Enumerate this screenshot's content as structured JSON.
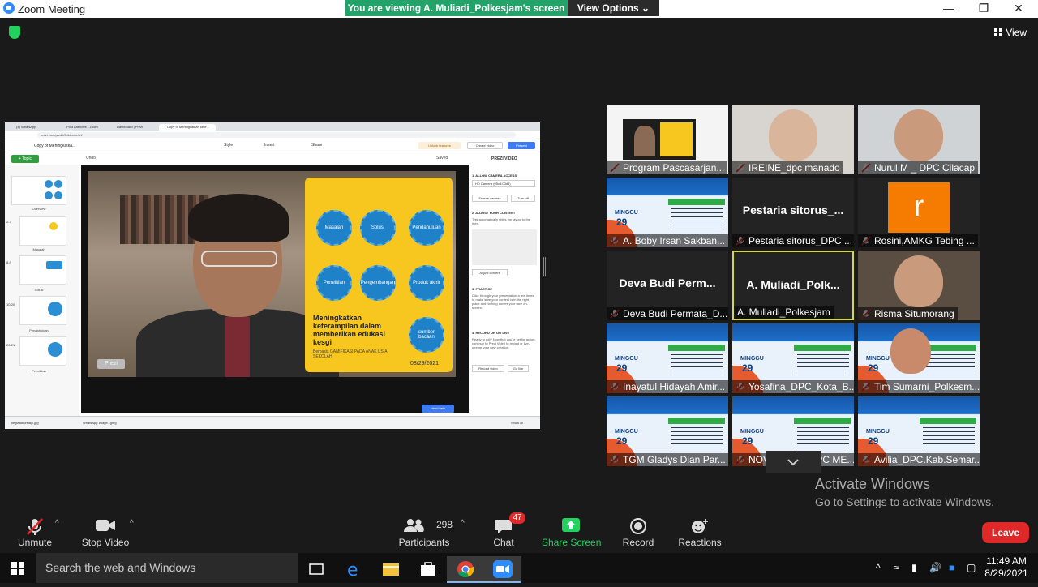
{
  "window": {
    "title": "Zoom Meeting",
    "viewing_banner": "You are viewing A. Muliadi_Polkesjam's screen",
    "view_options_label": "View Options",
    "view_label": "View"
  },
  "shared_screen": {
    "browser_tabs": [
      "(4) WhatsApp",
      "Post Attendee - Zoom",
      "Dashboard | Prezi",
      "Copy of Meningkatkan kete..."
    ],
    "url": "prezi.com/p/edit/3rlb6xdo-9rl/",
    "prezi_title": "Copy of Meningkatka...",
    "toolbar": {
      "style": "Style",
      "insert": "Insert",
      "share": "Share",
      "unlock": "Unlock features",
      "create_video": "Create video",
      "present": "Present"
    },
    "topic_button": "+ Topic",
    "undo": "Undo",
    "saved": "Saved",
    "thumbnails": [
      {
        "num": "",
        "label": "Overview"
      },
      {
        "num": "2-7",
        "label": "Masalah"
      },
      {
        "num": "8-9",
        "label": "Solusi"
      },
      {
        "num": "10-20",
        "label": "Pendahuluan"
      },
      {
        "num": "20-21",
        "label": "Penelitian"
      }
    ],
    "circles": [
      "Masalah",
      "Solusi",
      "Pendahuluan",
      "Penelitian",
      "Pengembangan",
      "Produk akhir",
      "sumber bacaan"
    ],
    "slide_title": "Meningkatkan keterampilan dalam memberikan edukasi kesgi",
    "slide_subtitle": "Berbasis GAMIFIKASI PADA ANAK USIA SEKOLAH",
    "slide_date": "08/29/2021",
    "prezi_badge": "Prezi",
    "need_help": "Need help",
    "right_panel": {
      "title": "PREZI VIDEO",
      "s1": "1. ALLOW CAMERA ACCESS",
      "camera": "HD Camera (05c8:03d8)",
      "freeze": "Freeze camera",
      "turn_off": "Turn off",
      "s2": "2. ADJUST YOUR CONTENT",
      "s2_text": "This automatically shifts the layout to the right.",
      "adjust": "Adjust content",
      "s3": "3. PRACTICE",
      "s3_text": "Click through your presentation a few times to make sure your content is in the right place and nothing covers your face on-screen.",
      "s4": "4. RECORD OR GO LIVE",
      "s4_text": "Ready to roll? Now that you're set for action, continue to Prezi Video to record or live-stream your new creation.",
      "record_video": "Record video",
      "go_live": "Go live"
    },
    "downloads": [
      "kegiatan-ireiagi.jpg",
      "WhatsApp Image...jpeg"
    ],
    "show_all": "Show all"
  },
  "gallery": [
    {
      "name": "Program Pascasarjan...",
      "muted": true,
      "type": "screen"
    },
    {
      "name": "IREINE_dpc manado",
      "muted": true,
      "type": "video"
    },
    {
      "name": "Nurul M _ DPC Cilacap",
      "muted": true,
      "type": "video"
    },
    {
      "name": "A. Boby Irsan Sakban...",
      "muted": true,
      "type": "seminar"
    },
    {
      "name": "Pestaria sitorus_DPC ...",
      "big": "Pestaria  sitorus_...",
      "muted": true,
      "type": "name"
    },
    {
      "name": "Rosini,AMKG Tebing ...",
      "muted": true,
      "type": "avatar",
      "letter": "r"
    },
    {
      "name": "Deva Budi Permata_D...",
      "big": "Deva Budi Perm...",
      "muted": true,
      "type": "name"
    },
    {
      "name": "A. Muliadi_Polkesjam",
      "big": "A.  Muliadi_Polk...",
      "muted": false,
      "type": "name",
      "active": true
    },
    {
      "name": "Risma Situmorang",
      "muted": true,
      "type": "video"
    },
    {
      "name": "Inayatul Hidayah Amir...",
      "muted": true,
      "type": "seminar"
    },
    {
      "name": "Yosafina_DPC_Kota_B...",
      "muted": true,
      "type": "seminar"
    },
    {
      "name": "Tim Sumarni_Polkesm...",
      "muted": true,
      "type": "seminar"
    },
    {
      "name": "TGM Gladys Dian Par...",
      "muted": true,
      "type": "seminar"
    },
    {
      "name": "NOVI DWI R_DPC ME...",
      "muted": true,
      "type": "seminar"
    },
    {
      "name": "Avilia_DPC.Kab.Semar...",
      "muted": true,
      "type": "seminar"
    }
  ],
  "seminar": {
    "minggu": "MINGGU",
    "day": "29",
    "banner": "SEMINAR NASIONAL"
  },
  "activate_windows": {
    "line1": "Activate Windows",
    "line2": "Go to Settings to activate Windows."
  },
  "controls": {
    "unmute": "Unmute",
    "stop_video": "Stop Video",
    "participants": "Participants",
    "participants_count": "298",
    "chat": "Chat",
    "chat_badge": "47",
    "share_screen": "Share Screen",
    "record": "Record",
    "reactions": "Reactions",
    "leave": "Leave"
  },
  "taskbar": {
    "search_placeholder": "Search the web and Windows",
    "time": "11:49 AM",
    "date": "8/29/2021"
  },
  "colors": {
    "share_green": "#23a36a",
    "leave_red": "#e02828",
    "active_tile": "#d4d845",
    "zoom_blue": "#2d8cff"
  }
}
